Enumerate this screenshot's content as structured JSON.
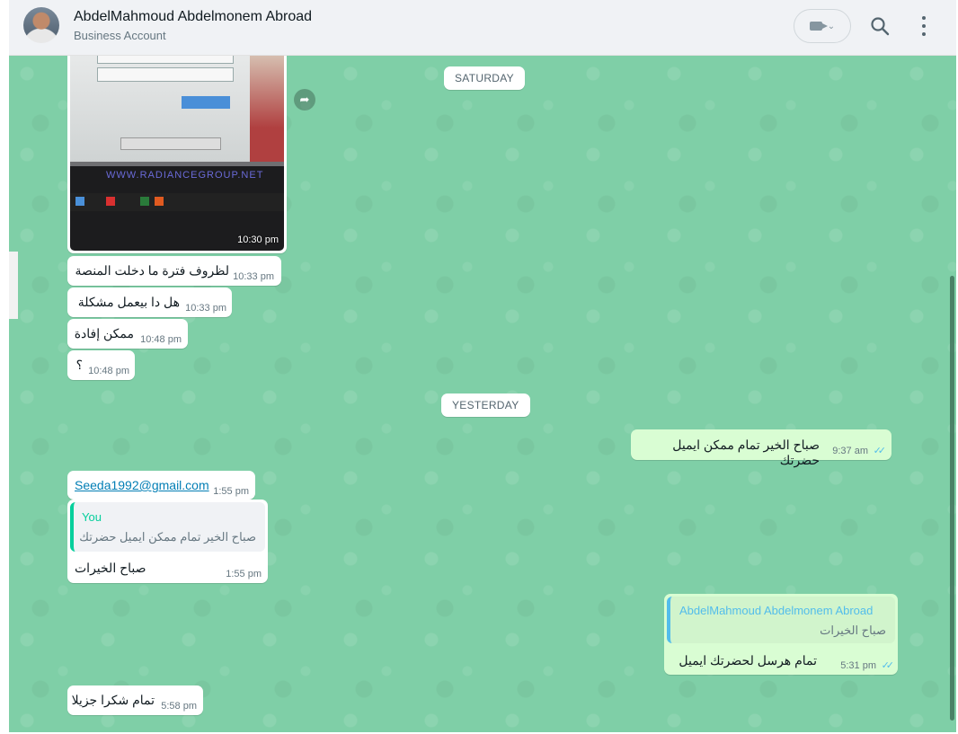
{
  "header": {
    "contact_name": "AbdelMahmoud Abdelmonem Abroad",
    "contact_subtitle": "Business Account",
    "video_chevron": "⌄"
  },
  "dividers": {
    "saturday": "SATURDAY",
    "yesterday": "YESTERDAY"
  },
  "messages": {
    "image": {
      "time": "10:30 pm",
      "site_text": "WWW.RADIANCEGROUP.NET"
    },
    "m1": {
      "text": "لظروف فترة ما دخلت المنصة",
      "time": "10:33 pm"
    },
    "m2": {
      "text": "هل دا بيعمل مشكلة",
      "time": "10:33 pm"
    },
    "m3": {
      "text": "ممكن إفادة",
      "time": "10:48 pm"
    },
    "m4": {
      "text": "؟",
      "time": "10:48 pm"
    },
    "m5": {
      "text": "صباح الخير تمام ممكن ايميل حضرتك",
      "time": "9:37 am",
      "status": "read"
    },
    "m6": {
      "text": "Seeda1992@gmail.com",
      "time": "1:55 pm"
    },
    "m7": {
      "quote_author": "You",
      "quote_text": "صباح الخير تمام ممكن ايميل حضرتك",
      "text": "صباح الخيرات",
      "time": "1:55 pm"
    },
    "m8": {
      "quote_author": "AbdelMahmoud Abdelmonem Abroad",
      "quote_text": "صباح الخيرات",
      "text": "تمام هرسل لحضرتك ايميل",
      "time": "5:31 pm",
      "status": "read"
    },
    "m9": {
      "text": "تمام شكرا جزيلا",
      "time": "5:58 pm"
    }
  },
  "colors": {
    "chat_background": "#7fcfa7",
    "incoming_bubble": "#ffffff",
    "outgoing_bubble": "#d9fdd3",
    "read_ticks": "#53bdeb",
    "quote_you": "#06cf9c",
    "quote_contact": "#53bdeb"
  },
  "icons": [
    "video-camera-icon",
    "search-icon",
    "more-options-icon",
    "forward-icon",
    "double-check-icon"
  ]
}
